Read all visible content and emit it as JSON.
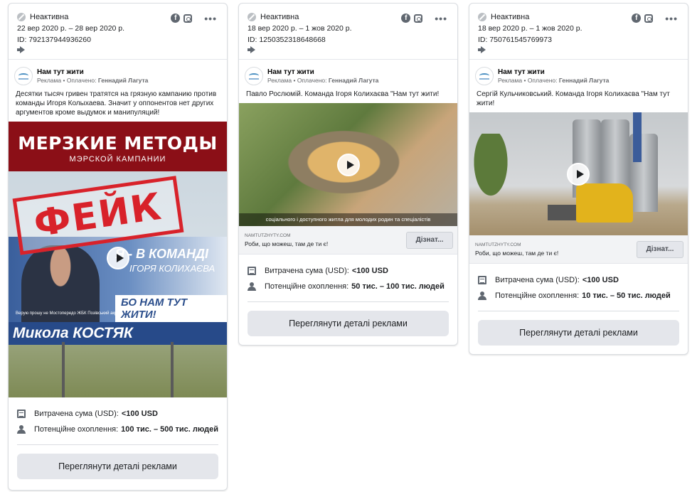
{
  "common": {
    "status": "Неактивна",
    "facebook_glyph": "f",
    "more_glyph": "•••",
    "page_name": "Нам тут жити",
    "sponsored_label": "Реклама",
    "paid_by_prefix": "• Оплачено:",
    "paid_by": "Геннадий Лагута",
    "spent_label": "Витрачена сума (USD):",
    "reach_label": "Потенційне охоплення:",
    "details_button": "Переглянути деталі реклами"
  },
  "cards": [
    {
      "dates": "22 вер 2020 р. – 28 вер 2020 р.",
      "id": "ID: 792137944936260",
      "ad_text": "Десятки тысяч гривен тратятся на грязную кампанию против команды Игоря Колыхаева. Значит у оппонентов нет других аргументов кроме выдумок и манипуляций!",
      "poster": {
        "headline": "МЕРЗКИЕ МЕТОДЫ",
        "subheadline": "МЭРСКОЙ КАМПАНИИ",
        "stamp": "ФЕЙК",
        "billboard_line1": "Я - В КОМАНДІ",
        "billboard_line2": "ІГОРЯ КОЛИХАЄВА",
        "billboard_slogan": "БО НАМ ТУТ ЖИТИ!",
        "billboard_small": "Верую прошу не Мостопередо ЖБК Позівський акр",
        "billboard_name": "Микола КОСТЯК"
      },
      "spent": "<100 USD",
      "reach": "100 тис. – 500 тис. людей"
    },
    {
      "dates": "18 вер 2020 р. – 1 жов 2020 р.",
      "id": "ID: 1250352318648668",
      "ad_text": "Павло Рослюмій. Команда Ігоря Колихаєва \"Нам тут жити!",
      "media_caption": "соціального і доступного житла для молодих родин та спеціалістів",
      "link_domain": "NAMTUTZHYTY.COM",
      "link_caption": "Роби, що можеш, там де ти є!",
      "cta": "Дізнат...",
      "spent": "<100 USD",
      "reach": "50 тис. – 100 тис. людей"
    },
    {
      "dates": "18 вер 2020 р. – 1 жов 2020 р.",
      "id": "ID: 750761545769973",
      "ad_text": "Сергій Кульчиковський. Команда Ігоря Колихаєва \"Нам тут жити!",
      "link_domain": "NAMTUTZHYTY.COM",
      "link_caption": "Роби, що можеш, там де ти є!",
      "cta": "Дізнат...",
      "spent": "<100 USD",
      "reach": "10 тис. – 50 тис. людей"
    }
  ]
}
